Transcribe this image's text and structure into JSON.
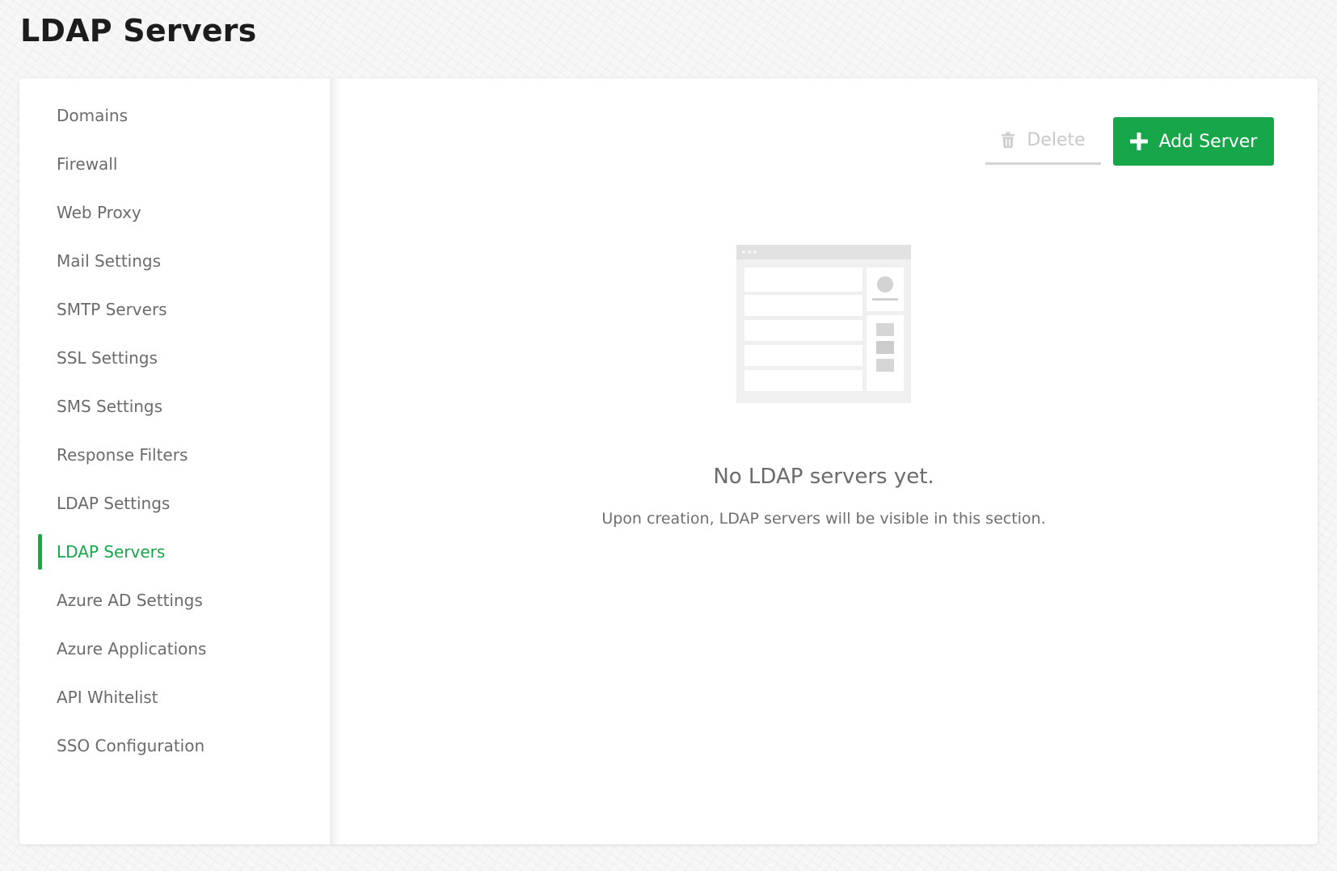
{
  "page": {
    "title": "LDAP Servers"
  },
  "sidebar": {
    "items": [
      {
        "label": "Domains",
        "active": false
      },
      {
        "label": "Firewall",
        "active": false
      },
      {
        "label": "Web Proxy",
        "active": false
      },
      {
        "label": "Mail Settings",
        "active": false
      },
      {
        "label": "SMTP Servers",
        "active": false
      },
      {
        "label": "SSL Settings",
        "active": false
      },
      {
        "label": "SMS Settings",
        "active": false
      },
      {
        "label": "Response Filters",
        "active": false
      },
      {
        "label": "LDAP Settings",
        "active": false
      },
      {
        "label": "LDAP Servers",
        "active": true
      },
      {
        "label": "Azure AD Settings",
        "active": false
      },
      {
        "label": "Azure Applications",
        "active": false
      },
      {
        "label": "API Whitelist",
        "active": false
      },
      {
        "label": "SSO Configuration",
        "active": false
      }
    ]
  },
  "toolbar": {
    "delete_label": "Delete",
    "delete_icon": "trash-icon",
    "delete_disabled": true,
    "add_label": "Add Server",
    "add_icon": "plus-icon"
  },
  "empty_state": {
    "illustration_icon": "empty-list-illustration",
    "title": "No LDAP servers yet.",
    "subtitle": "Upon creation, LDAP servers will be visible in this section."
  },
  "colors": {
    "accent": "#17a64a",
    "text_muted": "#6b6b6b",
    "disabled": "#c9c9c9"
  }
}
